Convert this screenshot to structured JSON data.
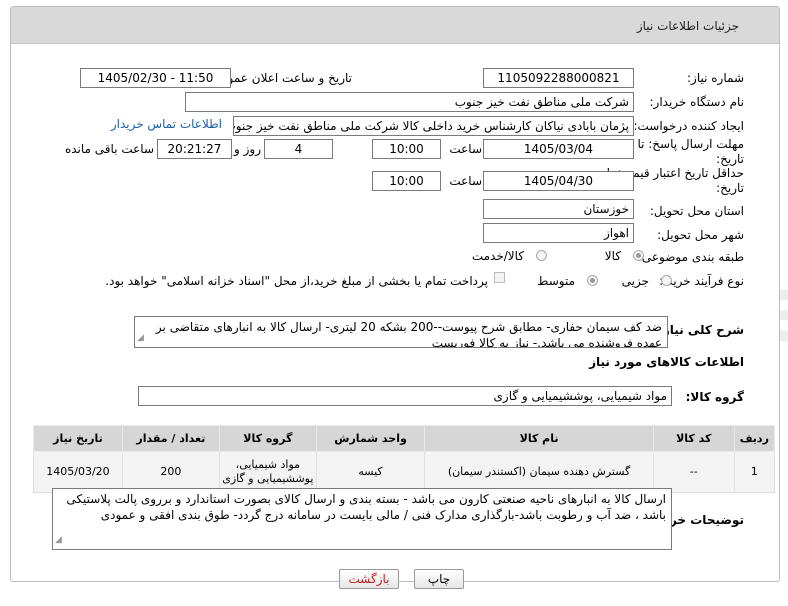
{
  "page": {
    "title": "جزئیات اطلاعات نیاز"
  },
  "form": {
    "need_number_label": "شماره نیاز:",
    "need_number": "1105092288000821",
    "announce_label": "تاریخ و ساعت اعلان عمومی:",
    "announce_value": "1405/02/30 - 11:50",
    "buyer_org_label": "نام دستگاه خریدار:",
    "buyer_org": "شرکت ملی مناطق نفت خیز جنوب",
    "creator_label": "ایجاد کننده درخواست:",
    "creator": "پژمان  بابادی نیاکان  کارشناس خرید داخلی کالا  شرکت ملی مناطق نفت خیز جنوب",
    "contact_link": "اطلاعات تماس خریدار",
    "reply_deadline_label": "مهلت ارسال پاسخ: تا تاریخ:",
    "reply_date": "1405/03/04",
    "time_label": "ساعت",
    "reply_time": "10:00",
    "days_value": "4",
    "days_label": "روز و",
    "remaining_time": "20:21:27",
    "remaining_label": "ساعت باقی مانده",
    "price_deadline_label": "حداقل تاریخ اعتبار قیمت: تا تاریخ:",
    "price_date": "1405/04/30",
    "price_time": "10:00",
    "province_label": "استان محل تحویل:",
    "province": "خوزستان",
    "city_label": "شهر محل تحویل:",
    "city": "اهواز",
    "category_label": "طبقه بندی موضوعی:",
    "category_options": [
      "کالا",
      "کالا/خدمت"
    ],
    "process_label": "نوع فرآیند خرید :",
    "process_options": [
      "جزیی",
      "متوسط"
    ],
    "payment_note": "پرداخت تمام یا بخشی از مبلغ خرید،از محل \"اسناد خزانه اسلامی\" خواهد بود.",
    "summary_label": "شرح کلی نیاز:",
    "summary": "ضد کف سیمان حفاری- مطابق شرح پیوست--200 بشکه 20 لیتری- ارسال کالا به انبارهای متقاضی بر عهده فروشنده می باشد.- نیاز به کالا فوریست",
    "goods_info_title": "اطلاعات کالاهای مورد نیاز",
    "goods_group_label": "گروه کالا:",
    "goods_group": "مواد شیمیایی، پوششیمیایی و  گازی"
  },
  "table": {
    "headers": [
      "ردیف",
      "کد کالا",
      "نام کالا",
      "واحد شمارش",
      "گروه کالا",
      "تعداد / مقدار",
      "تاریخ نیاز"
    ],
    "rows": [
      [
        "1",
        "--",
        "گسترش دهنده سیمان (اکستندر سیمان)",
        "کیسه",
        "مواد شیمیایی، پوششیمیایی و گازی",
        "200",
        "1405/03/20"
      ]
    ]
  },
  "buyer_notes": {
    "label": "توضیحات خریدار:",
    "text": "ارسال کالا به انبارهای  ناحیه صنعتی  کارون می باشد  -  بسته بندی و ارسال کالای بصورت استاندارد و برروی پالت پلاستیکی باشد ، ضد آب و رطوبت باشد-بارگذاری مدارک فنی / مالی بایست  در سامانه درج گردد- طوق بندی افقی و عمودی"
  },
  "buttons": {
    "print": "چاپ",
    "back": "بازگشت"
  }
}
